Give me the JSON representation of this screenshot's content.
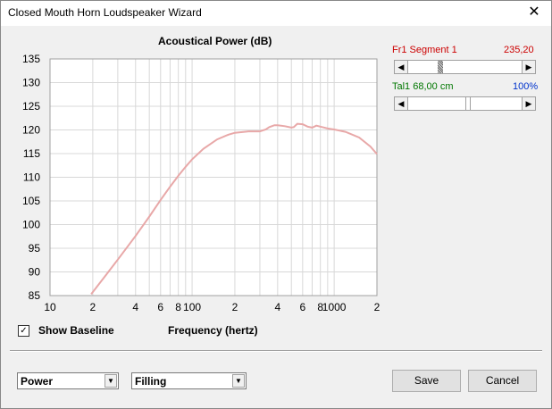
{
  "window": {
    "title": "Closed Mouth Horn Loudspeaker Wizard",
    "close_glyph": "✕"
  },
  "chart_data": {
    "type": "line",
    "title": "Acoustical Power (dB)",
    "xlabel": "Frequency (hertz)",
    "ylabel": "",
    "xscale": "log",
    "xlim": [
      10,
      2000
    ],
    "ylim": [
      85,
      135
    ],
    "y_ticks": [
      85,
      90,
      95,
      100,
      105,
      110,
      115,
      120,
      125,
      130,
      135
    ],
    "x_tick_labels": [
      {
        "value": 10,
        "label": "10"
      },
      {
        "value": 20,
        "label": "2"
      },
      {
        "value": 40,
        "label": "4"
      },
      {
        "value": 60,
        "label": "6"
      },
      {
        "value": 80,
        "label": "8"
      },
      {
        "value": 100,
        "label": "100"
      },
      {
        "value": 200,
        "label": "2"
      },
      {
        "value": 400,
        "label": "4"
      },
      {
        "value": 600,
        "label": "6"
      },
      {
        "value": 800,
        "label": "8"
      },
      {
        "value": 1000,
        "label": "1000"
      },
      {
        "value": 2000,
        "label": "2"
      }
    ],
    "grid": true,
    "series": [
      {
        "color": "#e8a8a8",
        "x": [
          19.5,
          25,
          30,
          40,
          50,
          60,
          70,
          80,
          90,
          100,
          120,
          150,
          180,
          200,
          250,
          300,
          330,
          350,
          380,
          400,
          450,
          500,
          520,
          550,
          600,
          650,
          700,
          750,
          800,
          900,
          1000,
          1200,
          1500,
          1800,
          2000
        ],
        "y": [
          85.3,
          89.5,
          92.6,
          97.6,
          101.7,
          105.2,
          108.0,
          110.3,
          112.2,
          113.8,
          116.0,
          118.0,
          119.0,
          119.4,
          119.7,
          119.7,
          120.1,
          120.6,
          121.0,
          121.0,
          120.8,
          120.5,
          120.6,
          121.3,
          121.2,
          120.7,
          120.5,
          120.9,
          120.7,
          120.3,
          120.1,
          119.6,
          118.4,
          116.5,
          114.9
        ]
      }
    ]
  },
  "controls": {
    "fr1_label": "Fr1  Segment 1",
    "fr1_value": "235,20",
    "fr1_color": "#cc0000",
    "tal1_label": "Tal1  68,00 cm",
    "tal1_value": "100%",
    "tal1_color": "#007700",
    "tal1_value_color": "#0033cc",
    "slider1_position": 0.26,
    "slider2_position": 0.5,
    "arrow_left": "◀",
    "arrow_right": "▶"
  },
  "options": {
    "show_baseline_label": "Show Baseline",
    "show_baseline_checked": "✓"
  },
  "footer": {
    "mode_select": "Power",
    "fill_select": "Filling",
    "save_label": "Save",
    "cancel_label": "Cancel",
    "drop_glyph": "▼"
  }
}
